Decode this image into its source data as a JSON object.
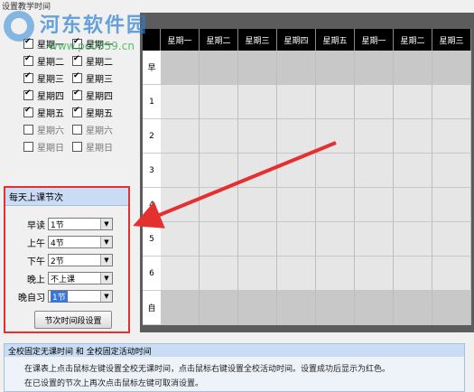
{
  "section_title": "设置教学时间",
  "watermark": {
    "site_name": "河东软件园",
    "url": "www.pc0359.cn"
  },
  "weekday_options": {
    "col1": [
      {
        "label": "星期一",
        "checked": true
      },
      {
        "label": "星期二",
        "checked": true
      },
      {
        "label": "星期三",
        "checked": true
      },
      {
        "label": "星期四",
        "checked": true
      },
      {
        "label": "星期五",
        "checked": true
      },
      {
        "label": "星期六",
        "checked": false
      },
      {
        "label": "星期日",
        "checked": false
      }
    ],
    "col2": [
      {
        "label": "星期一",
        "checked": true
      },
      {
        "label": "星期二",
        "checked": true
      },
      {
        "label": "星期三",
        "checked": true
      },
      {
        "label": "星期四",
        "checked": true
      },
      {
        "label": "星期五",
        "checked": true
      },
      {
        "label": "星期六",
        "checked": false
      },
      {
        "label": "星期日",
        "checked": false
      }
    ]
  },
  "periods": {
    "title": "每天上课节次",
    "rows": [
      {
        "label": "早读",
        "value": "1节"
      },
      {
        "label": "上午",
        "value": "4节"
      },
      {
        "label": "下午",
        "value": "2节"
      },
      {
        "label": "晚上",
        "value": "不上课"
      },
      {
        "label": "晚自习",
        "value": "1节"
      }
    ],
    "button_label": "节次时间段设置"
  },
  "timetable": {
    "columns": [
      "星期一",
      "星期二",
      "星期三",
      "星期四",
      "星期五",
      "星期一",
      "星期二",
      "星期三"
    ],
    "rows": [
      "早",
      "1",
      "2",
      "3",
      "4",
      "5",
      "6",
      "自"
    ]
  },
  "info": {
    "title": "全校固定无课时间 和 全校固定活动时间",
    "line1": "在课表上点击鼠标左键设置全校无课时间，点击鼠标右键设置全校活动时间。设置成功后显示为红色。",
    "line2": "在已设置的节次上再次点击鼠标左键可取消设置。"
  },
  "colors": {
    "highlight_border": "#e53030",
    "grid_header": "#000000",
    "cell_gray": "#c8c8c8",
    "cell_light": "#e6e6e6",
    "panel_header": "#c9dcf4"
  }
}
